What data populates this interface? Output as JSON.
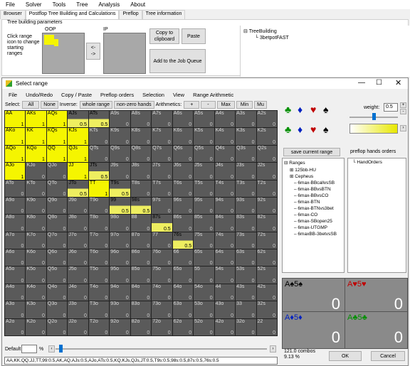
{
  "app": {
    "menu": [
      "File",
      "Solver",
      "Tools",
      "Tree",
      "Analysis",
      "About"
    ],
    "tabs": [
      "Browser",
      "Postflop Tree Building and Calculations",
      "Preflop",
      "Tree information"
    ],
    "params_label": "Tree building parameters",
    "oop_label": "OOP",
    "ip_label": "IP",
    "click_range_hint": "Click range icon to change starting ranges",
    "arrow_button": "<-\n->",
    "copy_button": "Copy to clipboard",
    "paste_button": "Paste",
    "add_queue_button": "Add to the Job Queue",
    "tree_root": "TreeBuilding",
    "tree_child": "3betpotFAST"
  },
  "dialog": {
    "title": "Select range",
    "menu": [
      "File",
      "Undo/Redo",
      "Copy / Paste",
      "Preflop orders",
      "Selection",
      "View",
      "Range Arithmetic"
    ],
    "toolbar": {
      "select_label": "Select:",
      "all": "All",
      "none": "None",
      "inverse_label": "Inverse:",
      "whole_range": "whole range",
      "nonzero": "non-zero hands",
      "arith_label": "Arithmetics:",
      "plus": "+",
      "minus": "-",
      "max": "Max",
      "min": "Min",
      "mu": "Mu"
    },
    "weight_label": "weight:",
    "weight_value": "0.5",
    "save_button": "save current range",
    "preflop_orders_label": "preflop hands orders",
    "ranges_root": "Ranges",
    "ranges": [
      "125bb-HU",
      "Cepheus",
      "6max-BBcallvsSB",
      "6max-BBvsBTN",
      "6max-BBvsCO",
      "6max-BTN",
      "6max-BTNvs3bet",
      "6max-CO",
      "6max-SBopen25",
      "6max-UTGMP",
      "6maxBB-3betvsSB"
    ],
    "hand_orders": "HandOrders",
    "combos": [
      {
        "label": "A♠5♠",
        "value": "0",
        "color": "#000"
      },
      {
        "label": "A♥5♥",
        "value": "0",
        "color": "#c00000"
      },
      {
        "label": "A♦5♦",
        "value": "0",
        "color": "#0020c0"
      },
      {
        "label": "A♣5♣",
        "value": "0",
        "color": "#009000"
      }
    ],
    "combos_count": "121.0 combos",
    "percent": "9.13 %",
    "default_label": "Default",
    "pct_sign": "%",
    "range_text": "AA,KK,QQ,JJ,TT,99:0.5,AK,AQ,AJs:0.5,AJo,ATs:0.5,KQ,KJs,QJs,JT:0.5,T9s:0.5,98s:0.5,87s:0.5,76s:0.5",
    "ok": "OK",
    "cancel": "Cancel",
    "grid": [
      [
        [
          "AA",
          "1"
        ],
        [
          "AKs",
          "1"
        ],
        [
          "AQs",
          "1"
        ],
        [
          "AJs",
          "0.5"
        ],
        [
          "ATs",
          "0.5"
        ],
        [
          "A9s",
          "0"
        ],
        [
          "A8s",
          "0"
        ],
        [
          "A7s",
          "0"
        ],
        [
          "A6s",
          "0"
        ],
        [
          "A5s",
          "0"
        ],
        [
          "A4s",
          "0"
        ],
        [
          "A3s",
          "0"
        ],
        [
          "A2s",
          "0"
        ]
      ],
      [
        [
          "AKo",
          "1"
        ],
        [
          "KK",
          "1"
        ],
        [
          "KQs",
          "1"
        ],
        [
          "KJs",
          "1"
        ],
        [
          "KTs",
          "0"
        ],
        [
          "K9s",
          "0"
        ],
        [
          "K8s",
          "0"
        ],
        [
          "K7s",
          "0"
        ],
        [
          "K6s",
          "0"
        ],
        [
          "K5s",
          "0"
        ],
        [
          "K4s",
          "0"
        ],
        [
          "K3s",
          "0"
        ],
        [
          "K2s",
          "0"
        ]
      ],
      [
        [
          "AQo",
          "1"
        ],
        [
          "KQo",
          "1"
        ],
        [
          "QQ",
          "1"
        ],
        [
          "QJs",
          "1"
        ],
        [
          "QTs",
          "0"
        ],
        [
          "Q9s",
          "0"
        ],
        [
          "Q8s",
          "0"
        ],
        [
          "Q7s",
          "0"
        ],
        [
          "Q6s",
          "0"
        ],
        [
          "Q5s",
          "0"
        ],
        [
          "Q4s",
          "0"
        ],
        [
          "Q3s",
          "0"
        ],
        [
          "Q2s",
          "0"
        ]
      ],
      [
        [
          "AJo",
          "1"
        ],
        [
          "KJo",
          "0"
        ],
        [
          "QJo",
          "0"
        ],
        [
          "JJ",
          "1"
        ],
        [
          "JTs",
          "0.5"
        ],
        [
          "J9s",
          "0"
        ],
        [
          "J8s",
          "0"
        ],
        [
          "J7s",
          "0"
        ],
        [
          "J6s",
          "0"
        ],
        [
          "J5s",
          "0"
        ],
        [
          "J4s",
          "0"
        ],
        [
          "J3s",
          "0"
        ],
        [
          "J2s",
          "0"
        ]
      ],
      [
        [
          "ATo",
          "0"
        ],
        [
          "KTo",
          "0"
        ],
        [
          "QTo",
          "0"
        ],
        [
          "JTo",
          "0.5"
        ],
        [
          "TT",
          "1"
        ],
        [
          "T9s",
          "0.5"
        ],
        [
          "T8s",
          "0"
        ],
        [
          "T7s",
          "0"
        ],
        [
          "T6s",
          "0"
        ],
        [
          "T5s",
          "0"
        ],
        [
          "T4s",
          "0"
        ],
        [
          "T3s",
          "0"
        ],
        [
          "T2s",
          "0"
        ]
      ],
      [
        [
          "A9o",
          "0"
        ],
        [
          "K9o",
          "0"
        ],
        [
          "Q9o",
          "0"
        ],
        [
          "J9o",
          "0"
        ],
        [
          "T9o",
          "0"
        ],
        [
          "99",
          "0.5"
        ],
        [
          "98s",
          "0.5"
        ],
        [
          "97s",
          "0"
        ],
        [
          "96s",
          "0"
        ],
        [
          "95s",
          "0"
        ],
        [
          "94s",
          "0"
        ],
        [
          "93s",
          "0"
        ],
        [
          "92s",
          "0"
        ]
      ],
      [
        [
          "A8o",
          "0"
        ],
        [
          "K8o",
          "0"
        ],
        [
          "Q8o",
          "0"
        ],
        [
          "J8o",
          "0"
        ],
        [
          "T8o",
          "0"
        ],
        [
          "98o",
          "0"
        ],
        [
          "88",
          "0"
        ],
        [
          "87s",
          "0.5"
        ],
        [
          "86s",
          "0"
        ],
        [
          "85s",
          "0"
        ],
        [
          "84s",
          "0"
        ],
        [
          "83s",
          "0"
        ],
        [
          "82s",
          "0"
        ]
      ],
      [
        [
          "A7o",
          "0"
        ],
        [
          "K7o",
          "0"
        ],
        [
          "Q7o",
          "0"
        ],
        [
          "J7o",
          "0"
        ],
        [
          "T7o",
          "0"
        ],
        [
          "97o",
          "0"
        ],
        [
          "87o",
          "0"
        ],
        [
          "77",
          "0"
        ],
        [
          "76s",
          "0.5"
        ],
        [
          "75s",
          "0"
        ],
        [
          "74s",
          "0"
        ],
        [
          "73s",
          "0"
        ],
        [
          "72s",
          "0"
        ]
      ],
      [
        [
          "A6o",
          "0"
        ],
        [
          "K6o",
          "0"
        ],
        [
          "Q6o",
          "0"
        ],
        [
          "J6o",
          "0"
        ],
        [
          "T6o",
          "0"
        ],
        [
          "96o",
          "0"
        ],
        [
          "86o",
          "0"
        ],
        [
          "76o",
          "0"
        ],
        [
          "66",
          "0"
        ],
        [
          "65s",
          "0"
        ],
        [
          "64s",
          "0"
        ],
        [
          "63s",
          "0"
        ],
        [
          "62s",
          "0"
        ]
      ],
      [
        [
          "A5o",
          "0"
        ],
        [
          "K5o",
          "0"
        ],
        [
          "Q5o",
          "0"
        ],
        [
          "J5o",
          "0"
        ],
        [
          "T5o",
          "0"
        ],
        [
          "95o",
          "0"
        ],
        [
          "85o",
          "0"
        ],
        [
          "75o",
          "0"
        ],
        [
          "65o",
          "0"
        ],
        [
          "55",
          "0"
        ],
        [
          "54s",
          "0"
        ],
        [
          "53s",
          "0"
        ],
        [
          "52s",
          "0"
        ]
      ],
      [
        [
          "A4o",
          "0"
        ],
        [
          "K4o",
          "0"
        ],
        [
          "Q4o",
          "0"
        ],
        [
          "J4o",
          "0"
        ],
        [
          "T4o",
          "0"
        ],
        [
          "94o",
          "0"
        ],
        [
          "84o",
          "0"
        ],
        [
          "74o",
          "0"
        ],
        [
          "64o",
          "0"
        ],
        [
          "54o",
          "0"
        ],
        [
          "44",
          "0"
        ],
        [
          "43s",
          "0"
        ],
        [
          "42s",
          "0"
        ]
      ],
      [
        [
          "A3o",
          "0"
        ],
        [
          "K3o",
          "0"
        ],
        [
          "Q3o",
          "0"
        ],
        [
          "J3o",
          "0"
        ],
        [
          "T3o",
          "0"
        ],
        [
          "93o",
          "0"
        ],
        [
          "83o",
          "0"
        ],
        [
          "73o",
          "0"
        ],
        [
          "63o",
          "0"
        ],
        [
          "53o",
          "0"
        ],
        [
          "43o",
          "0"
        ],
        [
          "33",
          "0"
        ],
        [
          "32s",
          "0"
        ]
      ],
      [
        [
          "A2o",
          "0"
        ],
        [
          "K2o",
          "0"
        ],
        [
          "Q2o",
          "0"
        ],
        [
          "J2o",
          "0"
        ],
        [
          "T2o",
          "0"
        ],
        [
          "92o",
          "0"
        ],
        [
          "82o",
          "0"
        ],
        [
          "72o",
          "0"
        ],
        [
          "62o",
          "0"
        ],
        [
          "52o",
          "0"
        ],
        [
          "42o",
          "0"
        ],
        [
          "32o",
          "0"
        ],
        [
          "22",
          "0"
        ]
      ]
    ]
  }
}
